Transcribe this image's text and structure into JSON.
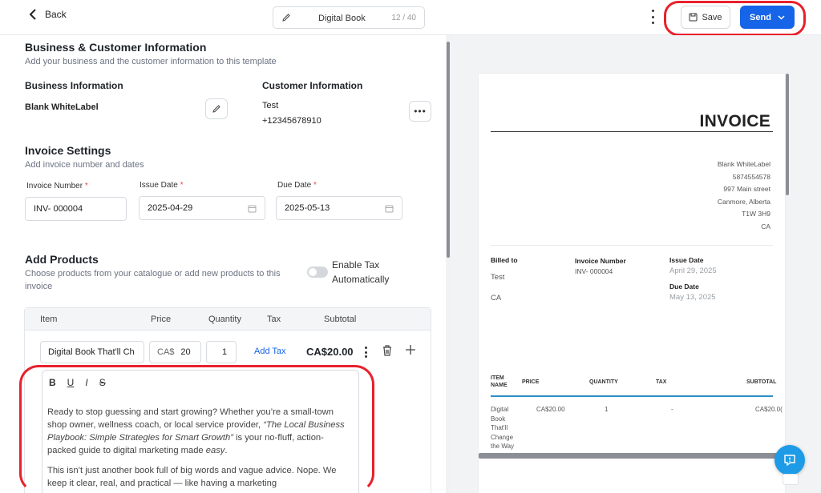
{
  "topbar": {
    "back_label": "Back",
    "doc_name": "Digital Book",
    "doc_count": "12 / 40",
    "save_label": "Save",
    "send_label": "Send"
  },
  "business_section": {
    "title": "Business & Customer Information",
    "subtitle": "Add your business and the customer information to this template",
    "business_heading": "Business Information",
    "business_name": "Blank WhiteLabel",
    "customer_heading": "Customer Information",
    "customer_name": "Test",
    "customer_phone": "+12345678910"
  },
  "invoice_settings": {
    "title": "Invoice Settings",
    "subtitle": "Add invoice number and dates",
    "number_label": "Invoice Number",
    "number_value": "INV- 000004",
    "issue_label": "Issue Date",
    "issue_value": "2025-04-29",
    "due_label": "Due Date",
    "due_value": "2025-05-13",
    "required_mark": "*"
  },
  "products": {
    "title": "Add Products",
    "subtitle_line1": "Choose products from your catalogue or add new products to this",
    "subtitle_line2": "invoice",
    "toggle_label_line1": "Enable Tax",
    "toggle_label_line2": "Automatically",
    "columns": [
      "Item",
      "Price",
      "Quantity",
      "Tax",
      "Subtotal"
    ],
    "row": {
      "item": "Digital Book That'll Ch",
      "price_currency": "CA$",
      "price": "20",
      "quantity": "1",
      "add_tax": "Add Tax",
      "subtotal": "CA$20.00"
    },
    "editor": {
      "toolbar": [
        "B",
        "U",
        "I",
        "S"
      ],
      "p1_a": "Ready to stop guessing and start growing? Whether you’re a small-town shop owner, wellness coach, or local service provider, ",
      "p1_italic": "“The Local Business Playbook: Simple Strategies for Smart Growth”",
      "p1_b": " is your no-fluff, action-packed guide to digital marketing made ",
      "p1_easy": "easy",
      "p1_end": ".",
      "p2": "This isn’t just another book full of big words and vague advice. Nope. We keep it clear, real, and practical — like having a marketing"
    }
  },
  "preview": {
    "title": "INVOICE",
    "address_lines": [
      "Blank WhiteLabel",
      "5874554578",
      "997 Main street",
      "Canmore, Alberta",
      "T1W 3H9",
      "CA"
    ],
    "billed_to_label": "Billed to",
    "billed_to_name": "Test",
    "billed_to_country": "CA",
    "invoice_number_label": "Invoice Number",
    "invoice_number_value": "INV- 000004",
    "issue_date_label": "Issue Date",
    "issue_date_value": "April 29, 2025",
    "due_date_label": "Due Date",
    "due_date_value": "May 13, 2025",
    "table_headers": [
      "ITEM NAME",
      "PRICE",
      "QUANTITY",
      "TAX",
      "SUBTOTAL"
    ],
    "item_name_lines": [
      "Digital",
      "Book",
      "That'll",
      "Change",
      "the Way"
    ],
    "item_price": "CA$20.00",
    "item_qty": "1",
    "item_tax": "-",
    "item_subtotal": "CA$20.0("
  },
  "colors": {
    "accent": "#1664e8",
    "highlight_oval": "#e8212c",
    "table_rule": "#2c8ec6"
  }
}
